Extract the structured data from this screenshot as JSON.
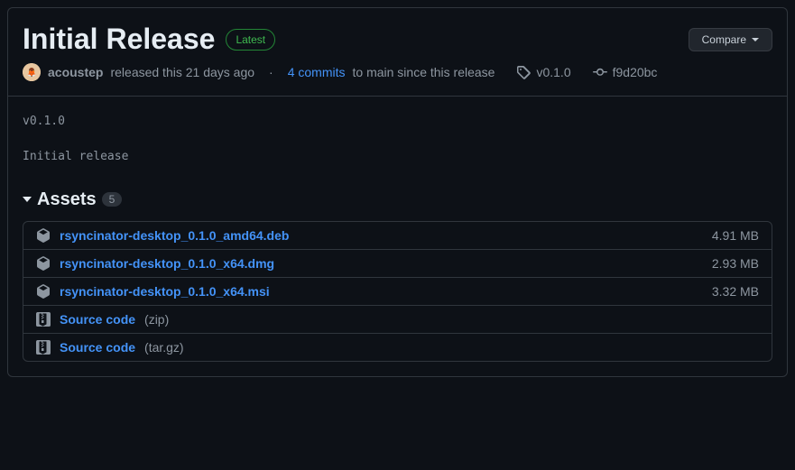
{
  "release": {
    "title": "Initial Release",
    "latestLabel": "Latest",
    "compareLabel": "Compare",
    "author": "acoustep",
    "releasedText": "released this 21 days ago",
    "commitsCount": "4 commits",
    "commitsSuffix": "to main since this release",
    "tag": "v0.1.0",
    "commitSha": "f9d20bc",
    "bodyVersion": "v0.1.0",
    "bodyText": "Initial release"
  },
  "assets": {
    "label": "Assets",
    "count": "5",
    "items": [
      {
        "name": "rsyncinator-desktop_0.1.0_amd64.deb",
        "size": "4.91 MB",
        "type": "package"
      },
      {
        "name": "rsyncinator-desktop_0.1.0_x64.dmg",
        "size": "2.93 MB",
        "type": "package"
      },
      {
        "name": "rsyncinator-desktop_0.1.0_x64.msi",
        "size": "3.32 MB",
        "type": "package"
      },
      {
        "name": "Source code",
        "ext": "(zip)",
        "size": "",
        "type": "zip"
      },
      {
        "name": "Source code",
        "ext": "(tar.gz)",
        "size": "",
        "type": "zip"
      }
    ]
  }
}
